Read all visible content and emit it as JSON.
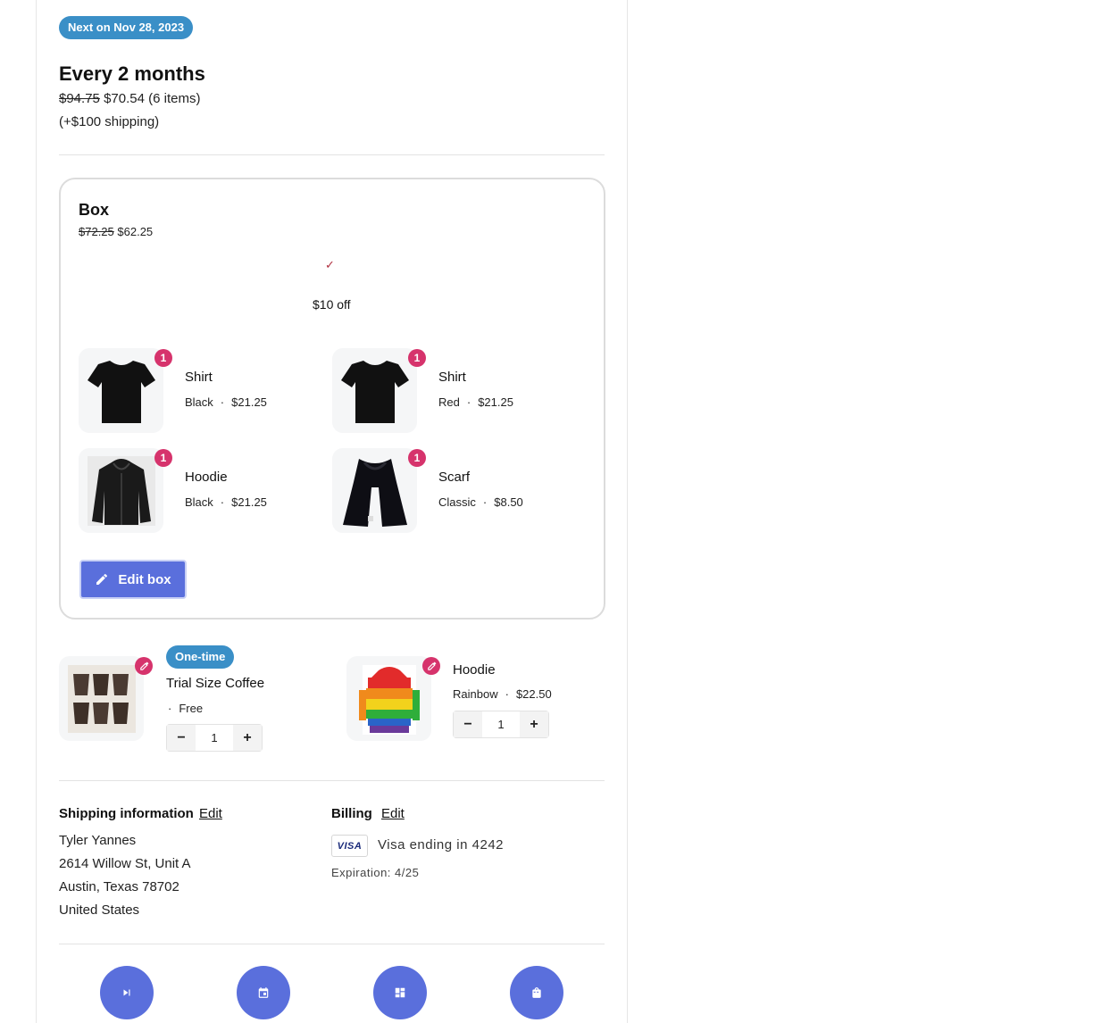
{
  "subscription": {
    "next_badge": "Next on Nov 28, 2023",
    "frequency": "Every 2 months",
    "original_price": "$94.75",
    "price_summary": "$70.54 (6 items)",
    "shipping": "(+$100 shipping)"
  },
  "box": {
    "title": "Box",
    "original_price": "$72.25",
    "price": "$62.25",
    "discount_label": "$10 off",
    "edit_button": "Edit box",
    "items": [
      {
        "name": "Shirt",
        "variant": "Black",
        "price": "$21.25",
        "qty": "1",
        "icon": "black-tshirt"
      },
      {
        "name": "Shirt",
        "variant": "Red",
        "price": "$21.25",
        "qty": "1",
        "icon": "black-tshirt"
      },
      {
        "name": "Hoodie",
        "variant": "Black",
        "price": "$21.25",
        "qty": "1",
        "icon": "black-hoodie"
      },
      {
        "name": "Scarf",
        "variant": "Classic",
        "price": "$8.50",
        "qty": "1",
        "icon": "black-scarf"
      }
    ]
  },
  "addons": [
    {
      "badge": "One-time",
      "name": "Trial Size Coffee",
      "meta": "Free",
      "qty": "1",
      "icon": "coffee-bags"
    },
    {
      "name": "Hoodie",
      "variant": "Rainbow",
      "price": "$22.50",
      "qty": "1",
      "icon": "rainbow-jacket"
    }
  ],
  "stepper": {
    "minus": "−",
    "plus": "+"
  },
  "shipping_info": {
    "title": "Shipping information",
    "edit": "Edit",
    "lines": [
      "Tyler Yannes",
      "2614 Willow St, Unit A",
      "Austin, Texas 78702",
      "United States"
    ]
  },
  "billing": {
    "title": "Billing",
    "edit": "Edit",
    "card_brand": "VISA",
    "card_text": "Visa ending in 4242",
    "expiration": "Expiration: 4/25"
  },
  "actions": [
    {
      "icon": "skip-next-icon"
    },
    {
      "icon": "calendar-icon"
    },
    {
      "icon": "dashboard-icon"
    },
    {
      "icon": "shopping-bag-icon"
    }
  ],
  "colors": {
    "accent": "#5a6fdc",
    "badge_blue": "#3a8fc7",
    "badge_pink": "#d6336c"
  }
}
